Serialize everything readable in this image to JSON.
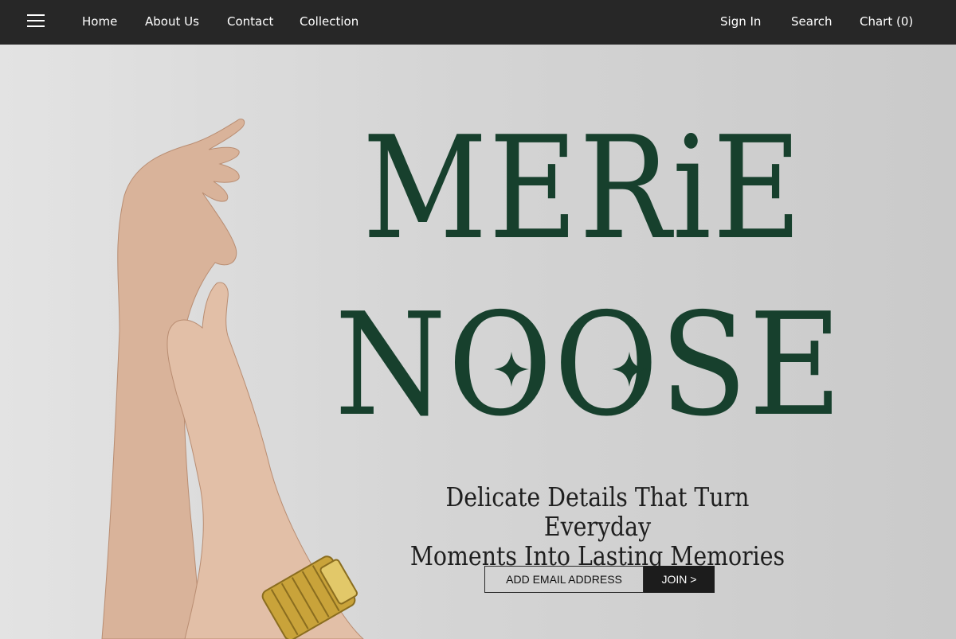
{
  "nav": {
    "menu_icon": "hamburger-menu-icon",
    "links": {
      "home": "Home",
      "about": "About Us",
      "contact": "Contact",
      "collection": "Collection",
      "sign_in": "Sign In",
      "search": "Search",
      "chart": "Chart (0)"
    }
  },
  "hero": {
    "title_line1": "MERiE",
    "title_line2": "NOOSE",
    "tagline_line1": "Delicate Details That Turn Everyday",
    "tagline_line2": "Moments Into Lasting Memories",
    "image": "hands-with-gold-watch-photo",
    "decor_icon": "four-point-star-icon"
  },
  "subscribe": {
    "email_placeholder": "ADD EMAIL ADDRESS",
    "join_label": "JOIN >"
  },
  "colors": {
    "nav_bg": "#272727",
    "title_green": "#17402d",
    "button_bg": "#1c1c1c"
  }
}
